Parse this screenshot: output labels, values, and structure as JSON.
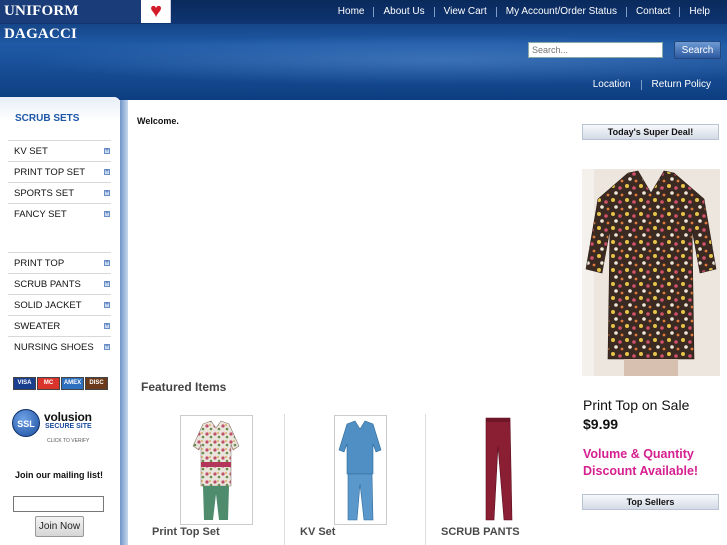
{
  "header": {
    "logo_text": "UNIFORM DAGACCI",
    "logo_icon": "heart-icon",
    "nav": [
      "Home",
      "About Us",
      "View Cart",
      "My Account/Order Status",
      "Contact",
      "Help"
    ],
    "search": {
      "placeholder": "Search...",
      "button_label": "Search"
    },
    "subnav": [
      "Location",
      "Return Policy"
    ]
  },
  "sidebar": {
    "title": "SCRUB SETS",
    "group1": [
      "KV SET",
      "PRINT TOP SET",
      "SPORTS SET",
      "FANCY SET"
    ],
    "group2": [
      "PRINT TOP",
      "SCRUB PANTS",
      "SOLID JACKET",
      "SWEATER",
      "NURSING SHOES"
    ],
    "card_logos": [
      "VISA",
      "MC",
      "AMEX",
      "DISC"
    ],
    "ssl": {
      "badge": "SSL",
      "name": "volusion",
      "sub": "SECURE SITE",
      "verify": "CLICK TO VERIFY"
    },
    "mailing": {
      "title": "Join our mailing list!",
      "button_label": "Join Now"
    }
  },
  "main": {
    "welcome": "Welcome.",
    "featured_title": "Featured Items",
    "products": [
      {
        "name": "Print Top Set"
      },
      {
        "name": "KV Set"
      },
      {
        "name": "SCRUB PANTS"
      }
    ]
  },
  "right": {
    "deal_title": "Today's Super Deal!",
    "deal_name": "Print Top on Sale",
    "deal_price": "$9.99",
    "deal_promo": "Volume & Quantity Discount Available!",
    "top_sellers_title": "Top Sellers"
  },
  "colors": {
    "header_blue": "#1f5aa6",
    "accent_blue": "#1e58a8",
    "promo_pink": "#d5208f",
    "heart_red": "#d31b2a"
  }
}
